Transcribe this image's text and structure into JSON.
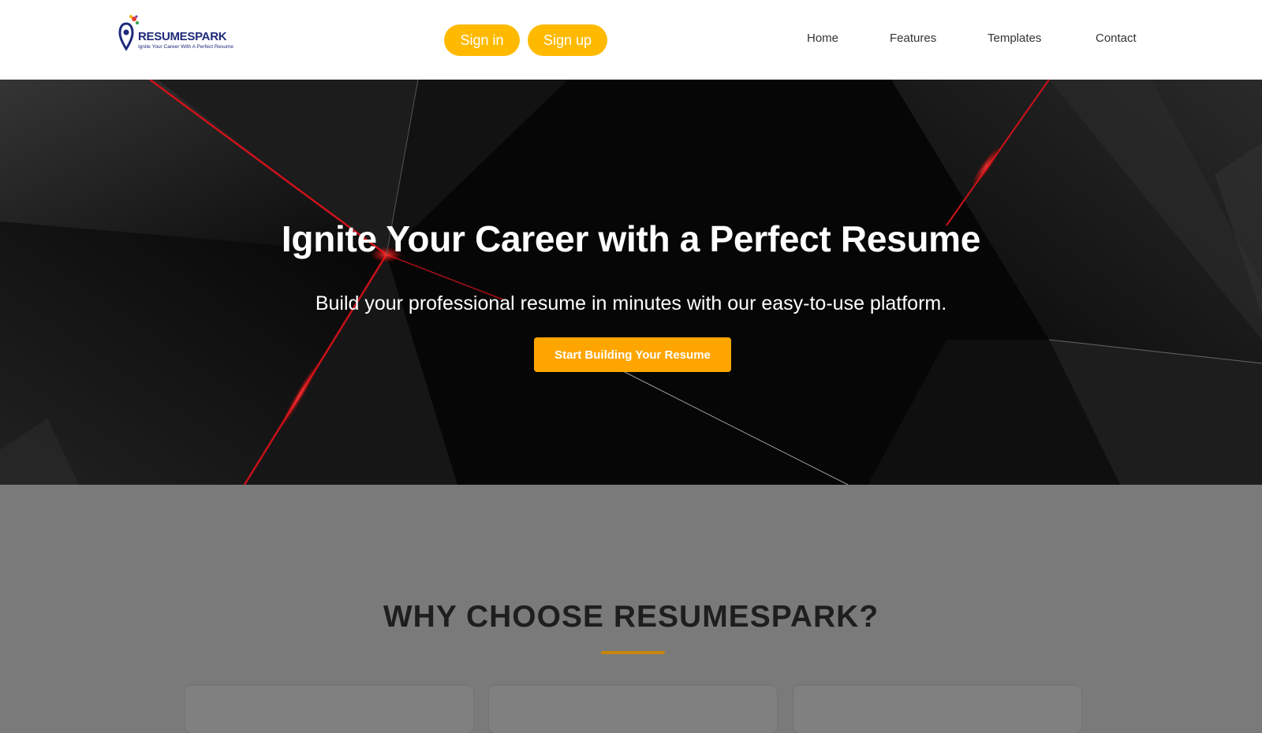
{
  "header": {
    "logo": {
      "name": "RESUMESPARK",
      "tagline": "Ignite Your Career With A Perfect Resume"
    },
    "auth": {
      "signin_label": "Sign in",
      "signup_label": "Sign up"
    },
    "nav": {
      "home": "Home",
      "features": "Features",
      "templates": "Templates",
      "contact": "Contact"
    }
  },
  "hero": {
    "title": "Ignite Your Career with a Perfect Resume",
    "subtitle": "Build your professional resume in minutes with our easy-to-use platform.",
    "cta_label": "Start Building Your Resume"
  },
  "features": {
    "title": "WHY CHOOSE RESUMESPARK?"
  },
  "colors": {
    "accent": "#ffba00",
    "cta": "#ffa500",
    "underline": "#c8860a",
    "brand": "#1e2a7a",
    "section_bg": "#7a7a7a"
  },
  "icons": {
    "logo_mark": "resume-pin-icon"
  }
}
